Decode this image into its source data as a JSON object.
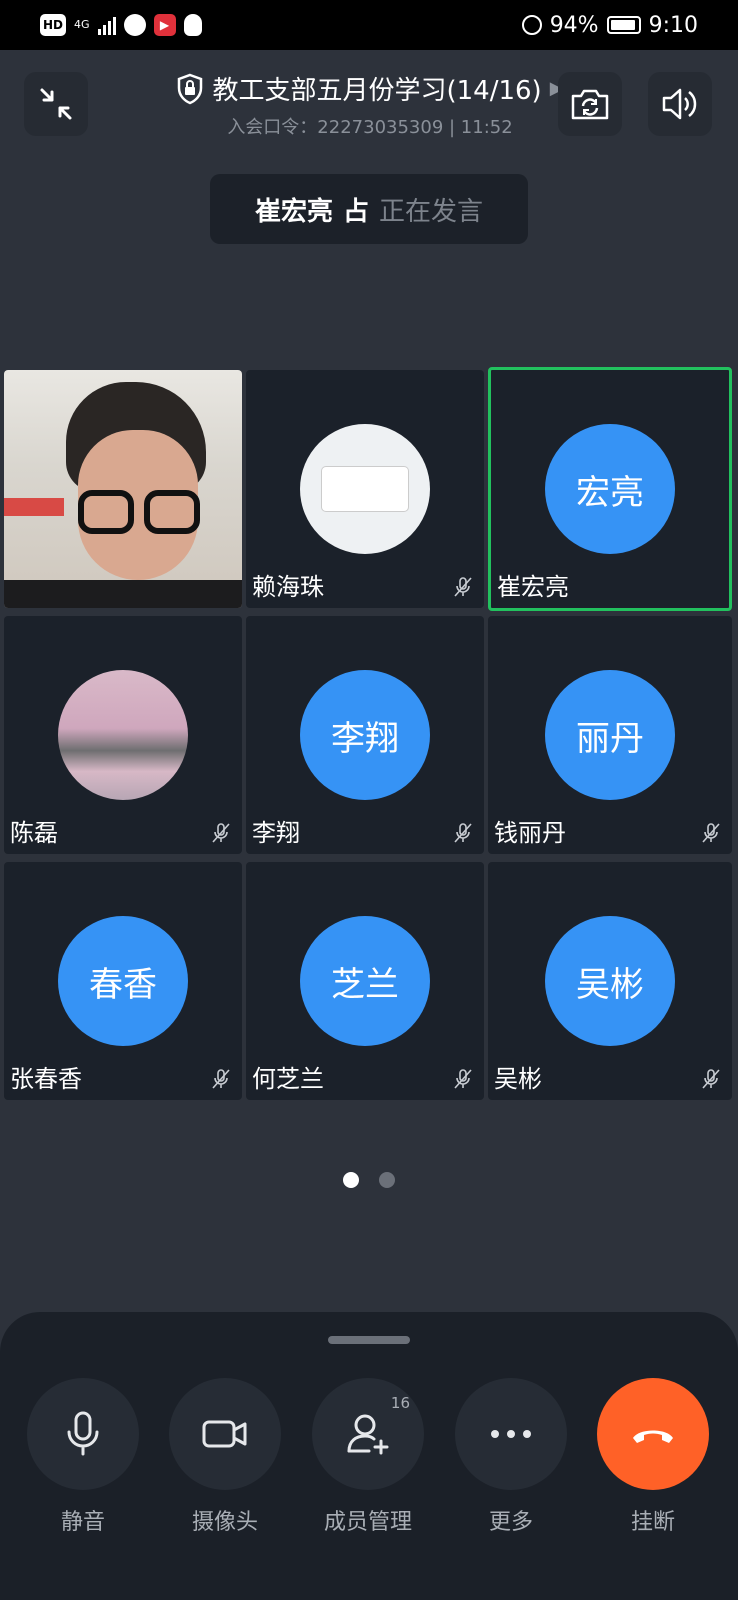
{
  "status_bar": {
    "hd": "HD",
    "network": "4G",
    "battery": "94%",
    "time": "9:10"
  },
  "header": {
    "title": "教工支部五月份学习(14/16)",
    "subtitle": "入会口令：22273035309 | 11:52",
    "left_icon": "minimize-icon",
    "camera_icon": "switch-camera-icon",
    "speaker_icon": "speaker-icon"
  },
  "speaking": {
    "name": "崔宏亮",
    "status": "正在发言"
  },
  "participants": [
    {
      "name": "",
      "avatar_text": "",
      "type": "video",
      "muted": false
    },
    {
      "name": "赖海珠",
      "avatar_text": "",
      "type": "image-avatar",
      "muted": true
    },
    {
      "name": "崔宏亮",
      "avatar_text": "宏亮",
      "type": "text-avatar",
      "muted": false,
      "active": true
    },
    {
      "name": "陈磊",
      "avatar_text": "",
      "type": "image-avatar",
      "muted": true
    },
    {
      "name": "李翔",
      "avatar_text": "李翔",
      "type": "text-avatar",
      "muted": true
    },
    {
      "name": "钱丽丹",
      "avatar_text": "丽丹",
      "type": "text-avatar",
      "muted": true
    },
    {
      "name": "张春香",
      "avatar_text": "春香",
      "type": "text-avatar",
      "muted": true
    },
    {
      "name": "何芝兰",
      "avatar_text": "芝兰",
      "type": "text-avatar",
      "muted": true
    },
    {
      "name": "吴彬",
      "avatar_text": "吴彬",
      "type": "text-avatar",
      "muted": true
    }
  ],
  "pager": {
    "pages": 2,
    "current": 1
  },
  "controls": {
    "mute_label": "静音",
    "camera_label": "摄像头",
    "members_label": "成员管理",
    "members_count": "16",
    "more_label": "更多",
    "hangup_label": "挂断"
  },
  "colors": {
    "accent_blue": "#3693f5",
    "active_border": "#22c15e",
    "hangup": "#ff6127"
  }
}
